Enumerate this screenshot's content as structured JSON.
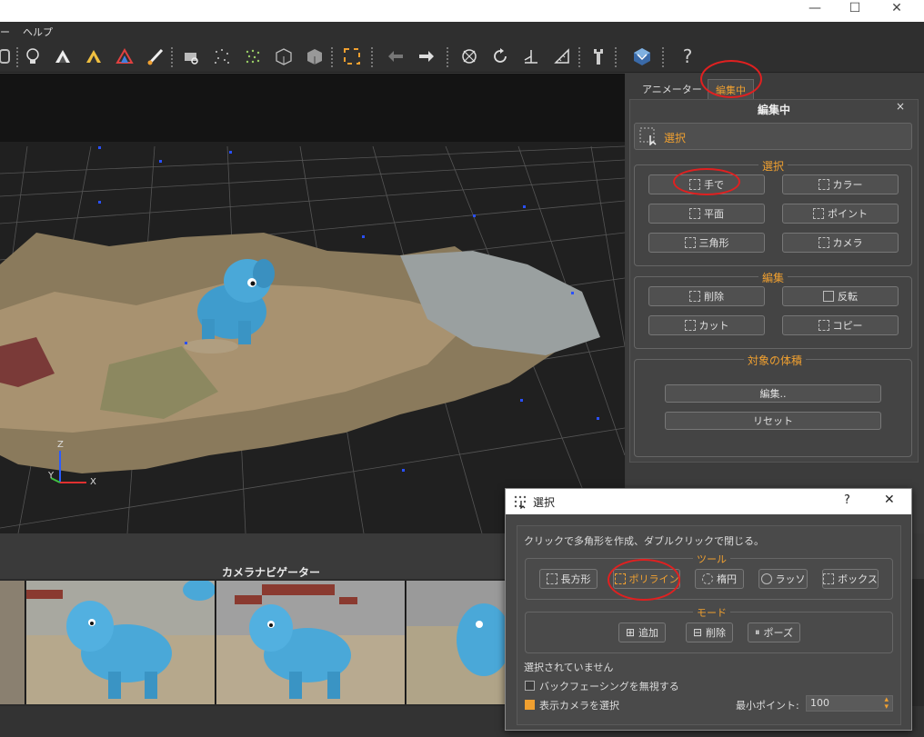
{
  "window": {
    "minimize": "—",
    "maximize": "☐",
    "close": "✕"
  },
  "menu": {
    "items": [
      "ー",
      "ヘルプ"
    ]
  },
  "toolbar": {
    "help": "?"
  },
  "viewport": {
    "axis_z": "Z",
    "axis_y": "Y",
    "axis_x": "X"
  },
  "tabs": [
    {
      "label": "アニメーター"
    },
    {
      "label": "編集中"
    }
  ],
  "panel": {
    "title": "編集中",
    "close": "×",
    "selection_header": "選択",
    "group_select": {
      "title": "選択",
      "buttons": [
        "手で",
        "カラー",
        "平面",
        "ポイント",
        "三角形",
        "カメラ"
      ]
    },
    "group_edit": {
      "title": "編集",
      "buttons": [
        "削除",
        "反転",
        "カット",
        "コピー"
      ]
    },
    "group_volume": {
      "title": "対象の体積",
      "buttons": [
        "編集..",
        "リセット"
      ]
    }
  },
  "camera_navigator": {
    "title": "カメラナビゲーター"
  },
  "dialog": {
    "title": "選択",
    "help": "?",
    "close": "✕",
    "hint": "クリックで多角形を作成、ダブルクリックで閉じる。",
    "tools_title": "ツール",
    "tools": [
      "長方形",
      "ポリライン",
      "楕円",
      "ラッソ",
      "ボックス"
    ],
    "mode_title": "モード",
    "modes": [
      "追加",
      "削除",
      "ポーズ"
    ],
    "status": "選択されていません",
    "ignore_backfacing": "バックフェーシングを無視する",
    "select_display_camera": "表示カメラを選択",
    "min_points_label": "最小ポイント:",
    "min_points_value": "100"
  },
  "colors": {
    "accent": "#f0a030",
    "highlight": "#e02020",
    "background": "#3a3a3a"
  }
}
